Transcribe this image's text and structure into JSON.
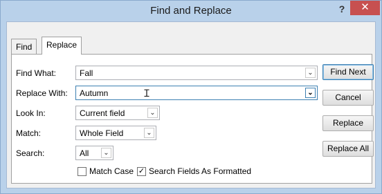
{
  "window": {
    "title": "Find and Replace",
    "help_glyph": "?",
    "close_glyph": "✕"
  },
  "tabs": [
    {
      "label": "Find"
    },
    {
      "label": "Replace"
    }
  ],
  "fields": {
    "find_what": {
      "label": "Find What:",
      "value": "Fall"
    },
    "replace_with": {
      "label": "Replace With:",
      "value": "Autumn"
    },
    "look_in": {
      "label": "Look In:",
      "value": "Current field"
    },
    "match": {
      "label": "Match:",
      "value": "Whole Field"
    },
    "search": {
      "label": "Search:",
      "value": "All"
    }
  },
  "checkboxes": {
    "match_case": {
      "label": "Match Case",
      "checked": false
    },
    "search_formatted": {
      "label": "Search Fields As Formatted",
      "checked": true
    }
  },
  "buttons": {
    "find_next": "Find Next",
    "cancel": "Cancel",
    "replace": "Replace",
    "replace_all": "Replace All"
  },
  "glyphs": {
    "dropdown": "⌄",
    "check": "✓",
    "ibeam": "Ｉ"
  }
}
